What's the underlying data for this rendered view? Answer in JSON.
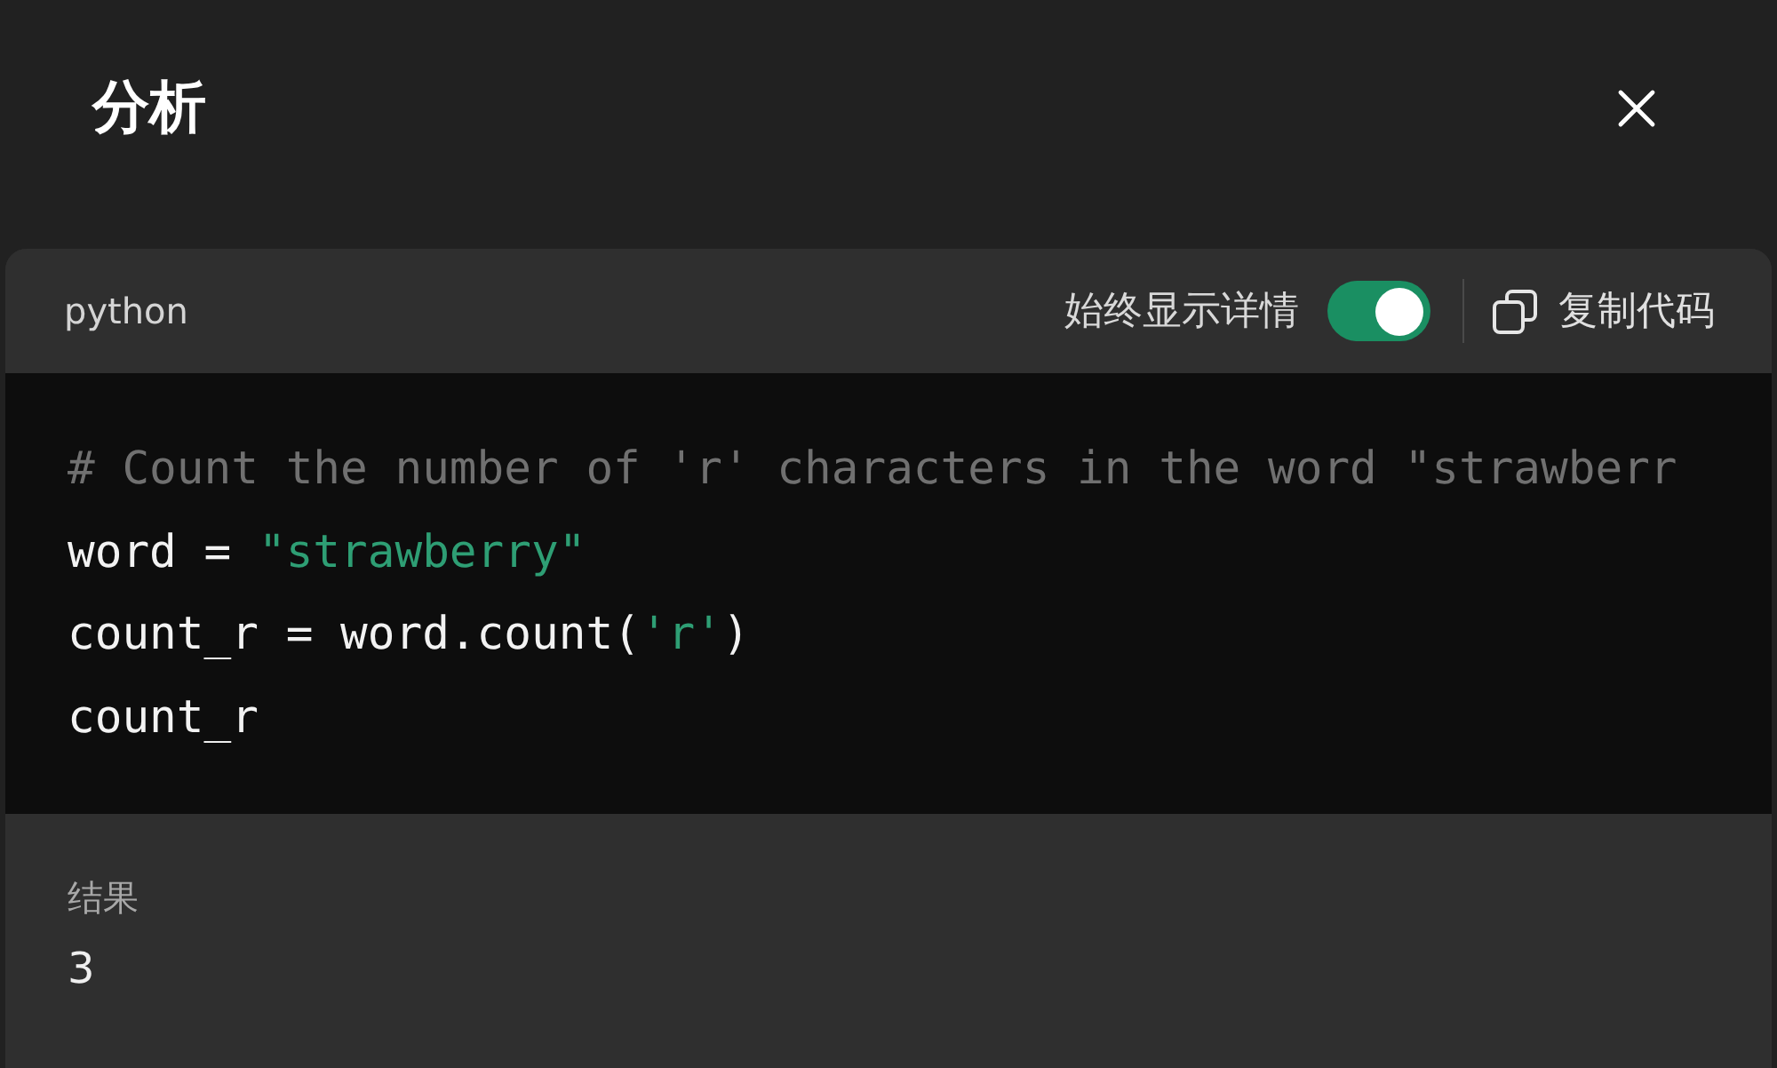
{
  "dialog": {
    "title": "分析"
  },
  "code_block": {
    "language": "python",
    "details_toggle": {
      "label": "始终显示详情",
      "on": true
    },
    "copy_button": {
      "label": "复制代码"
    },
    "lines": [
      [
        {
          "kind": "comment",
          "text": "# Count the number of 'r' characters in the word \"strawberr"
        }
      ],
      [
        {
          "kind": "plain",
          "text": "word = "
        },
        {
          "kind": "string",
          "text": "\"strawberry\""
        }
      ],
      [
        {
          "kind": "plain",
          "text": "count_r = word.count("
        },
        {
          "kind": "string",
          "text": "'r'"
        },
        {
          "kind": "plain",
          "text": ")"
        }
      ],
      [
        {
          "kind": "plain",
          "text": "count_r"
        }
      ]
    ]
  },
  "result": {
    "label": "结果",
    "value": "3"
  }
}
